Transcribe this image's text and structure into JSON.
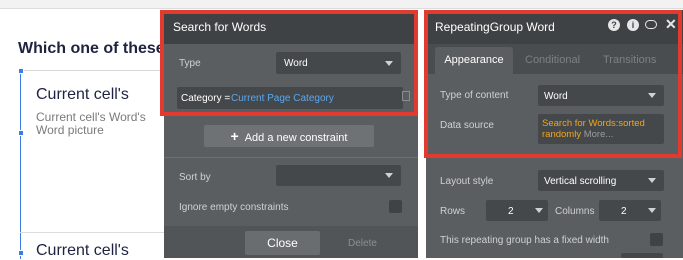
{
  "canvas": {
    "question": "Which one of these",
    "cell1_title": "Current cell's",
    "cell1_sub": "Current cell's Word's Word picture",
    "cell2_title": "Current cell's"
  },
  "search_panel": {
    "title": "Search for Words",
    "type_label": "Type",
    "type_value": "Word",
    "constraint_key": "Category =",
    "constraint_value": "Current Page Category",
    "add_constraint": "Add a new constraint",
    "sort_by_label": "Sort by",
    "sort_by_value": "",
    "ignore_label": "Ignore empty constraints",
    "close_label": "Close",
    "delete_label": "Delete"
  },
  "rg_panel": {
    "title": "RepeatingGroup Word",
    "tabs": [
      "Appearance",
      "Conditional",
      "Transitions"
    ],
    "type_of_content_label": "Type of content",
    "type_of_content_value": "Word",
    "data_source_label": "Data source",
    "data_source_value": "Search for Words:sorted randomly",
    "data_source_more": "More...",
    "layout_style_label": "Layout style",
    "layout_style_value": "Vertical scrolling",
    "rows_label": "Rows",
    "rows_value": "2",
    "columns_label": "Columns",
    "columns_value": "2",
    "fixed_width_label": "This repeating group has a fixed width"
  },
  "colors": {
    "highlight": "#e13b30",
    "accent_blue": "#5aa7f0",
    "accent_orange": "#f0a622"
  }
}
